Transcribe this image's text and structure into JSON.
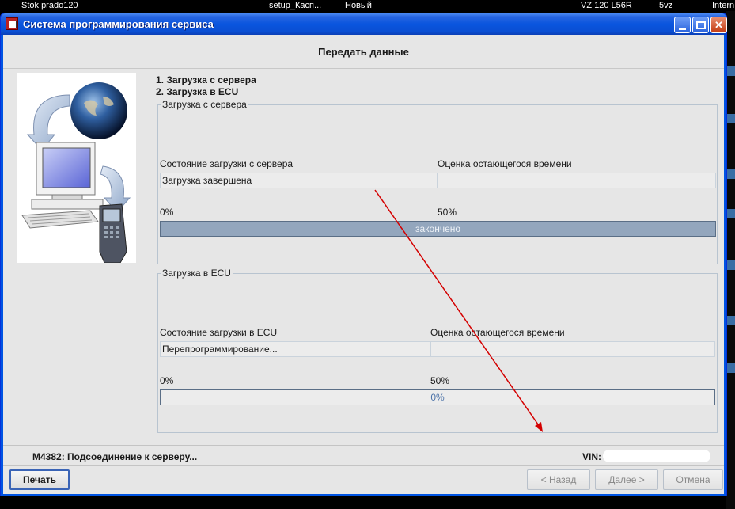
{
  "background": {
    "taskbar_items": [
      "Stok prado120",
      "setup_Касп...",
      "Новый",
      "VZ 120 L56R",
      "5vz",
      "Intern"
    ]
  },
  "window": {
    "title": "Система программирования сервиса",
    "titlebar_color": "#0a55de"
  },
  "page": {
    "heading": "Передать данные",
    "steps": [
      "1. Загрузка с сервера",
      "2. Загрузка в ECU"
    ]
  },
  "server_group": {
    "legend": "Загрузка с сервера",
    "state_label": "Состояние загрузки с сервера",
    "time_label": "Оценка остающегося времени",
    "state_value": "Загрузка завершена",
    "time_value": "",
    "tick_start": "0%",
    "tick_mid": "50%",
    "progress_text": "закончено",
    "progress_fraction": 1.0,
    "progress_color": "#93a6bd"
  },
  "ecu_group": {
    "legend": "Загрузка в ECU",
    "state_label": "Состояние загрузки в ECU",
    "time_label": "Оценка остающегося времени",
    "state_value": "Перепрограммирование...",
    "time_value": "",
    "tick_start": "0%",
    "tick_mid": "50%",
    "progress_text": "0%",
    "progress_fraction": 0.0
  },
  "status": {
    "message": "M4382: Подсоединение к серверу...",
    "vin_label": "VIN:"
  },
  "buttons": {
    "print": "Печать",
    "back": "< Назад",
    "next": "Далее >",
    "cancel": "Отмена"
  },
  "annotation": {
    "arrow_color": "#d40000"
  }
}
